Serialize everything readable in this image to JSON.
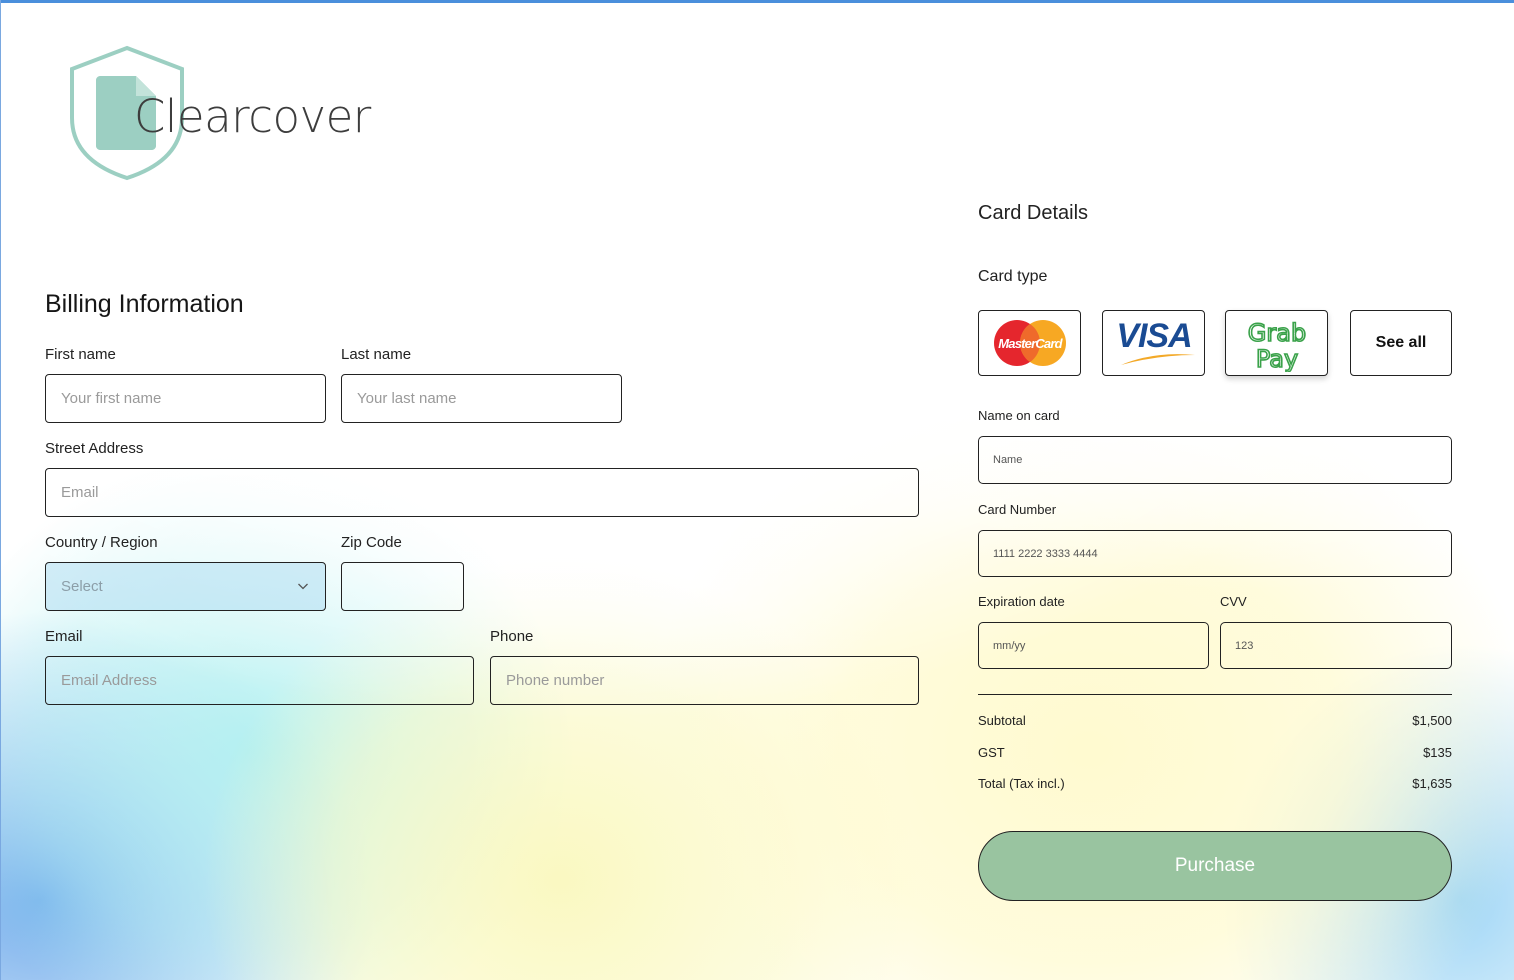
{
  "brand": {
    "name": "Clearcover",
    "logo_color": "#8dc7b9",
    "accent_color": "#99c4a0"
  },
  "billing": {
    "title": "Billing Information",
    "first_name": {
      "label": "First name",
      "placeholder": "Your first name"
    },
    "last_name": {
      "label": "Last name",
      "placeholder": "Your last name"
    },
    "street": {
      "label": "Street Address",
      "placeholder": "Email"
    },
    "country": {
      "label": "Country / Region",
      "value": "Select"
    },
    "zip": {
      "label": "Zip Code",
      "placeholder": ""
    },
    "email": {
      "label": "Email",
      "placeholder": "Email Address"
    },
    "phone": {
      "label": "Phone",
      "placeholder": "Phone number"
    }
  },
  "card": {
    "title": "Card Details",
    "type_label": "Card type",
    "options": [
      {
        "name": "MasterCard",
        "icon": "mastercard-icon"
      },
      {
        "name": "VISA",
        "icon": "visa-icon"
      },
      {
        "name": "GrabPay",
        "icon": "grabpay-icon"
      }
    ],
    "see_all": "See all",
    "name_on_card": {
      "label": "Name on card",
      "placeholder": "Name"
    },
    "card_number": {
      "label": "Card Number",
      "placeholder": "1111 2222 3333 4444"
    },
    "expiration": {
      "label": "Expiration date",
      "placeholder": "mm/yy"
    },
    "cvv": {
      "label": "CVV",
      "placeholder": "123"
    }
  },
  "summary": {
    "subtotal": {
      "label": "Subtotal",
      "value": "$1,500"
    },
    "gst": {
      "label": "GST",
      "value": "$135"
    },
    "total": {
      "label": "Total (Tax incl.)",
      "value": "$1,635"
    }
  },
  "purchase_label": "Purchase"
}
